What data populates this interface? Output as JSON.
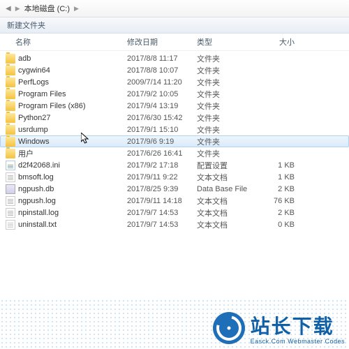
{
  "breadcrumb": {
    "drive": "本地磁盘 (C:)",
    "arrow": "▶",
    "nav": "◀"
  },
  "toolbar": {
    "label": "新建文件夹"
  },
  "columns": {
    "name": "名称",
    "date": "修改日期",
    "type": "类型",
    "size": "大小"
  },
  "files": [
    {
      "icon": "folder",
      "name": "adb",
      "date": "2017/8/8 11:17",
      "type": "文件夹",
      "size": ""
    },
    {
      "icon": "folder",
      "name": "cygwin64",
      "date": "2017/8/8 10:07",
      "type": "文件夹",
      "size": ""
    },
    {
      "icon": "folder",
      "name": "PerfLogs",
      "date": "2009/7/14 11:20",
      "type": "文件夹",
      "size": ""
    },
    {
      "icon": "folder",
      "name": "Program Files",
      "date": "2017/9/2 10:05",
      "type": "文件夹",
      "size": ""
    },
    {
      "icon": "folder",
      "name": "Program Files (x86)",
      "date": "2017/9/4 13:19",
      "type": "文件夹",
      "size": ""
    },
    {
      "icon": "folder",
      "name": "Python27",
      "date": "2017/6/30 15:42",
      "type": "文件夹",
      "size": ""
    },
    {
      "icon": "folder",
      "name": "usrdump",
      "date": "2017/9/1 15:10",
      "type": "文件夹",
      "size": ""
    },
    {
      "icon": "folder",
      "name": "Windows",
      "date": "2017/9/6 9:19",
      "type": "文件夹",
      "size": "",
      "selected": true
    },
    {
      "icon": "folder",
      "name": "用户",
      "date": "2017/6/26 16:41",
      "type": "文件夹",
      "size": ""
    },
    {
      "icon": "ini",
      "name": "d2f42068.ini",
      "date": "2017/9/2 17:18",
      "type": "配置设置",
      "size": "1 KB"
    },
    {
      "icon": "log",
      "name": "bmsoft.log",
      "date": "2017/9/11 9:22",
      "type": "文本文档",
      "size": "1 KB"
    },
    {
      "icon": "db",
      "name": "ngpush.db",
      "date": "2017/8/25 9:39",
      "type": "Data Base File",
      "size": "2 KB"
    },
    {
      "icon": "log",
      "name": "ngpush.log",
      "date": "2017/9/11 14:18",
      "type": "文本文档",
      "size": "76 KB"
    },
    {
      "icon": "log",
      "name": "npinstall.log",
      "date": "2017/9/7 14:53",
      "type": "文本文档",
      "size": "2 KB"
    },
    {
      "icon": "txt",
      "name": "uninstall.txt",
      "date": "2017/9/7 14:53",
      "type": "文本文档",
      "size": "0 KB"
    }
  ],
  "watermark": {
    "cn": "站长下载",
    "en": "Easck.Com Webmaster Codes"
  }
}
